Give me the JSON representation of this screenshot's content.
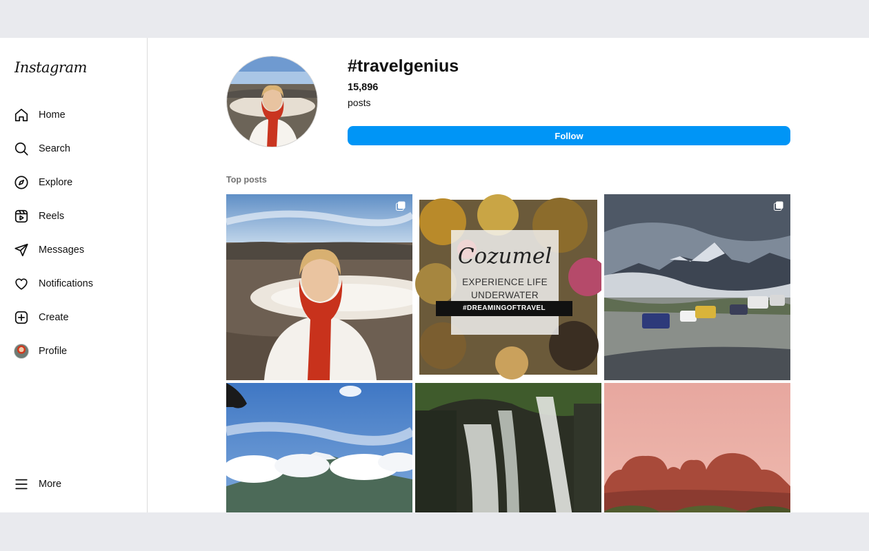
{
  "app": {
    "logo_text": "Instagram"
  },
  "sidebar": {
    "items": [
      {
        "label": "Home",
        "icon": "home-icon"
      },
      {
        "label": "Search",
        "icon": "search-icon"
      },
      {
        "label": "Explore",
        "icon": "compass-icon"
      },
      {
        "label": "Reels",
        "icon": "reels-icon"
      },
      {
        "label": "Messages",
        "icon": "paper-plane-icon"
      },
      {
        "label": "Notifications",
        "icon": "heart-icon"
      },
      {
        "label": "Create",
        "icon": "plus-square-icon"
      },
      {
        "label": "Profile",
        "icon": "avatar"
      }
    ],
    "more_label": "More"
  },
  "hashtag": {
    "name": "#travelgenius",
    "post_count": "15,896",
    "post_count_label": "posts",
    "follow_label": "Follow"
  },
  "top_posts": {
    "title": "Top posts",
    "posts": [
      {
        "subject": "woman-in-red-scarf-at-crater",
        "multi_image": true
      },
      {
        "subject": "cozumel-promo",
        "script_title": "Cozumel",
        "subtitle_line1": "EXPERIENCE LIFE",
        "subtitle_line2": "UNDERWATER",
        "tag": "#DREAMINGOFTRAVEL",
        "multi_image": false
      },
      {
        "subject": "mountain-camper-vans",
        "multi_image": true
      },
      {
        "subject": "snowcapped-mountain-town",
        "multi_image": false
      },
      {
        "subject": "waterfall",
        "multi_image": false
      },
      {
        "subject": "red-rock-domes-sunset",
        "multi_image": false
      }
    ]
  },
  "colors": {
    "accent": "#0095f6",
    "page_bg": "#e9eaee",
    "border": "#dbdbdb"
  }
}
